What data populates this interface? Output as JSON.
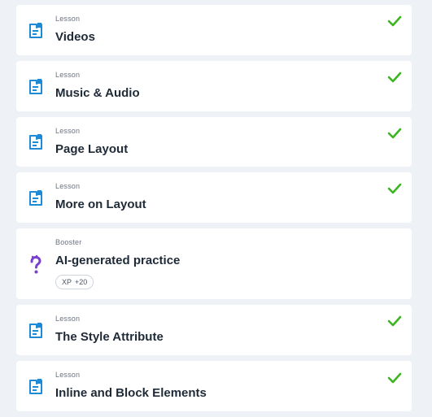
{
  "colors": {
    "background": "#eef1f5",
    "card": "#ffffff",
    "lesson_icon": "#1e8ad6",
    "booster_icon": "#7a3fd0",
    "check": "#3cb521",
    "title_text": "#1f2a37"
  },
  "items": [
    {
      "kind": "Lesson",
      "title": "Videos",
      "icon": "document-icon",
      "completed": true
    },
    {
      "kind": "Lesson",
      "title": "Music & Audio",
      "icon": "document-icon",
      "completed": true
    },
    {
      "kind": "Lesson",
      "title": "Page Layout",
      "icon": "document-icon",
      "completed": true
    },
    {
      "kind": "Lesson",
      "title": "More on Layout",
      "icon": "document-icon",
      "completed": true
    },
    {
      "kind": "Booster",
      "title": "AI-generated practice",
      "icon": "question-mark-icon",
      "completed": false,
      "xp_label": "XP",
      "xp_value": "+20"
    },
    {
      "kind": "Lesson",
      "title": "The Style Attribute",
      "icon": "document-icon",
      "completed": true
    },
    {
      "kind": "Lesson",
      "title": "Inline and Block Elements",
      "icon": "document-icon",
      "completed": true
    }
  ]
}
